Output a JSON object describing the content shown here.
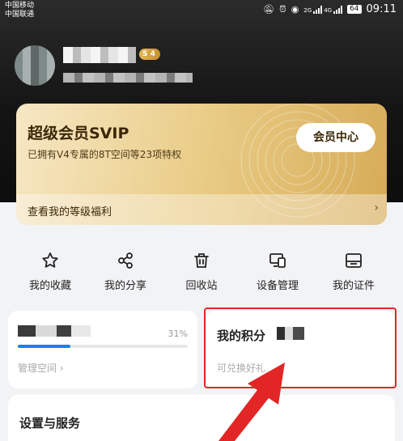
{
  "status_bar": {
    "carrier_1": "中国移动",
    "carrier_2": "中国联通",
    "network_1": "2G",
    "network_2": "4G",
    "battery": "64",
    "time": "09:11",
    "icons": [
      "mute-icon",
      "alarm-icon",
      "eye-icon",
      "signal-icon",
      "battery-icon"
    ]
  },
  "profile": {
    "level_badge": "S 4"
  },
  "svip": {
    "title": "超级会员SVIP",
    "subtitle": "已拥有V4专属的8T空间等23项特权",
    "center_button": "会员中心",
    "benefits_link": "查看我的等级福利"
  },
  "actions": [
    {
      "label": "我的收藏",
      "icon": "star-icon"
    },
    {
      "label": "我的分享",
      "icon": "share-icon"
    },
    {
      "label": "回收站",
      "icon": "trash-icon"
    },
    {
      "label": "设备管理",
      "icon": "devices-icon"
    },
    {
      "label": "我的证件",
      "icon": "id-card-icon"
    }
  ],
  "storage": {
    "percent_label": "31%",
    "usage_fraction": 0.31,
    "manage_label": "管理空间 ›"
  },
  "points": {
    "title": "我的积分",
    "subtitle": "可兑换好礼"
  },
  "settings": {
    "title": "设置与服务"
  },
  "colors": {
    "accent_blue": "#1e7cf2",
    "highlight_red": "#e22525",
    "svip_gold": "#e9cc86"
  }
}
